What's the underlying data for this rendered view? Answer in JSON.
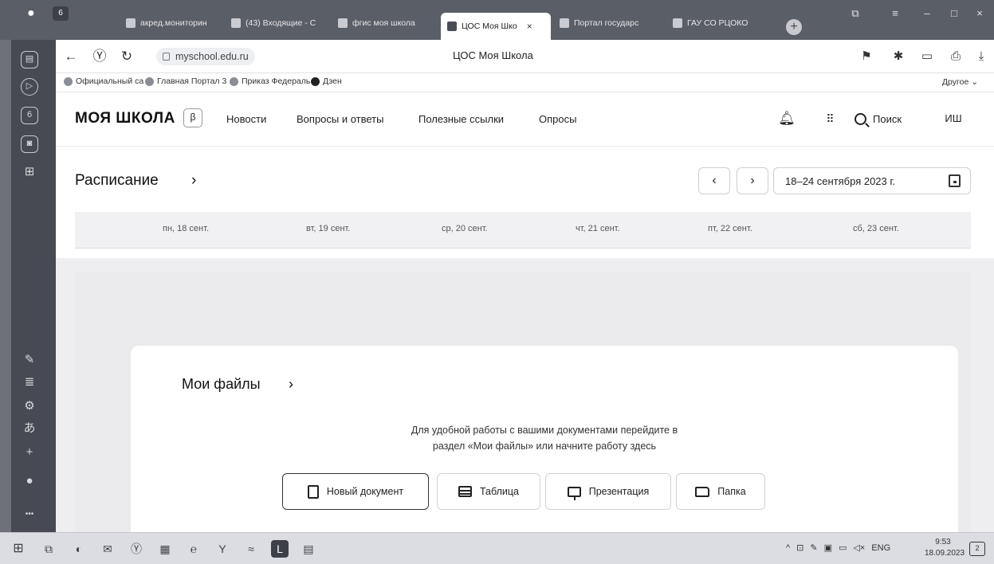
{
  "browser": {
    "tab_counter": "6",
    "tabs": [
      {
        "label": "акред.мониторин",
        "active": false
      },
      {
        "label": "(43) Входящие - С",
        "active": false
      },
      {
        "label": "фгис моя школа",
        "active": false
      },
      {
        "label": "ЦОС Моя Шко",
        "active": true
      },
      {
        "label": "Портал государс",
        "active": false
      },
      {
        "label": "ГАУ СО РЦОКО",
        "active": false
      }
    ],
    "close_glyph": "×",
    "url": "myschool.edu.ru",
    "page_title": "ЦОС Моя Школа",
    "bookmarks": [
      {
        "label": "Официальный са"
      },
      {
        "label": "Главная Портал 3"
      },
      {
        "label": "Приказ Федераль"
      },
      {
        "label": "Дзен"
      }
    ],
    "bookmarks_other": "Другое ⌄"
  },
  "site": {
    "logo": "МОЯ ШКОЛА",
    "beta": "β",
    "nav": [
      {
        "label": "Новости"
      },
      {
        "label": "Вопросы и ответы"
      },
      {
        "label": "Полезные ссылки"
      },
      {
        "label": "Опросы"
      }
    ],
    "search_label": "Поиск",
    "avatar_initials": "ИШ"
  },
  "schedule": {
    "title": "Расписание",
    "chevron": "›",
    "prev": "‹",
    "next": "›",
    "date_range": "18–24 сентября 2023 г.",
    "days": [
      {
        "label": "пн, 18 сент."
      },
      {
        "label": "вт, 19 сент."
      },
      {
        "label": "ср, 20 сент."
      },
      {
        "label": "чт, 21 сент."
      },
      {
        "label": "пт, 22 сент."
      },
      {
        "label": "сб, 23 сент."
      }
    ]
  },
  "files": {
    "title": "Мои файлы",
    "chevron": "›",
    "hint_line1": "Для удобной работы с вашими документами перейдите в",
    "hint_line2": "раздел «Мои файлы» или начните работу здесь",
    "buttons": [
      {
        "label": "Новый документ",
        "icon": "document-icon"
      },
      {
        "label": "Таблица",
        "icon": "table-icon"
      },
      {
        "label": "Презентация",
        "icon": "presentation-icon"
      },
      {
        "label": "Папка",
        "icon": "folder-icon"
      }
    ]
  },
  "taskbar": {
    "lang": "ENG",
    "time": "9:53",
    "date": "18.09.2023"
  }
}
